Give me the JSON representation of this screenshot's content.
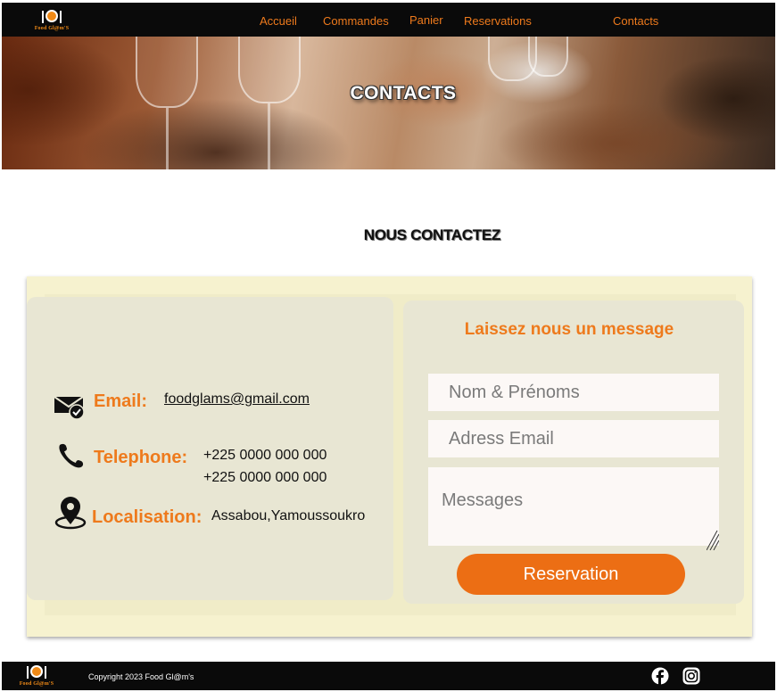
{
  "brand": {
    "name": "Food Gl@m'S"
  },
  "nav": {
    "items": [
      {
        "label": "Accueil"
      },
      {
        "label": "Commandes"
      },
      {
        "label": "Panier"
      },
      {
        "label": "Reservations"
      },
      {
        "label": "Contacts"
      }
    ]
  },
  "hero": {
    "title": "CONTACTS"
  },
  "section": {
    "title": "NOUS CONTACTEZ"
  },
  "contact_info": {
    "email": {
      "label": "Email:",
      "value": "foodglams@gmail.com"
    },
    "telephone": {
      "label": "Telephone:",
      "lines": [
        "+225 0000 000 000",
        "+225 0000 000 000"
      ]
    },
    "location": {
      "label": "Localisation:",
      "value": "Assabou,Yamoussoukro"
    }
  },
  "form": {
    "title": "Laissez nous un message",
    "name_placeholder": "Nom & Prénoms",
    "email_placeholder": "Adress Email",
    "message_placeholder": "Messages",
    "submit_label": "Reservation"
  },
  "footer": {
    "copyright": "Copyright 2023  Food Gl@m's"
  },
  "icons": [
    "email-check-icon",
    "phone-icon",
    "location-pin-icon",
    "facebook-icon",
    "instagram-icon"
  ],
  "colors": {
    "accent": "#ee7a1c",
    "button": "#ec6e14",
    "panel": "#e8e6d3",
    "box": "#f6f2cf",
    "bar": "#0a0a0a"
  }
}
